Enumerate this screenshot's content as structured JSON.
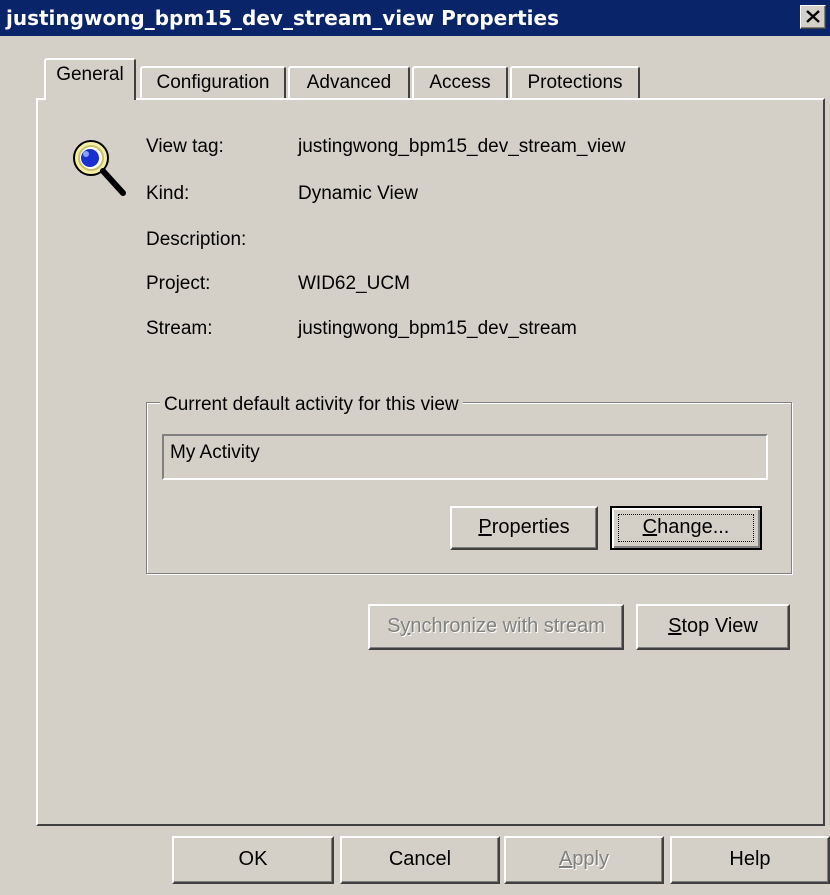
{
  "window": {
    "title": "justingwong_bpm15_dev_stream_view Properties"
  },
  "tabs": [
    {
      "label": "General",
      "active": true
    },
    {
      "label": "Configuration",
      "active": false
    },
    {
      "label": "Advanced",
      "active": false
    },
    {
      "label": "Access",
      "active": false
    },
    {
      "label": "Protections",
      "active": false
    }
  ],
  "general": {
    "icon": "magnifier-icon",
    "fields": [
      {
        "label": "View tag:",
        "value": "justingwong_bpm15_dev_stream_view"
      },
      {
        "label": "Kind:",
        "value": "Dynamic View"
      },
      {
        "label": "Description:",
        "value": ""
      },
      {
        "label": "Project:",
        "value": "WID62_UCM"
      },
      {
        "label": "Stream:",
        "value": "justingwong_bpm15_dev_stream"
      }
    ],
    "activity_group": {
      "legend": "Current default activity for this view",
      "activity": "My Activity",
      "properties_button": {
        "mnemonic": "P",
        "rest": "roperties"
      },
      "change_button": {
        "mnemonic": "C",
        "rest": "hange..."
      }
    },
    "synchronize_button": {
      "pre": "S",
      "mnemonic": "y",
      "rest": "nchronize with stream",
      "disabled": true
    },
    "stop_view_button": {
      "mnemonic": "S",
      "rest": "top View"
    }
  },
  "footer": {
    "ok": "OK",
    "cancel": "Cancel",
    "apply": {
      "mnemonic": "A",
      "rest": "pply",
      "disabled": true
    },
    "help": "Help"
  },
  "colors": {
    "titlebar": "#0a246a",
    "face": "#d4d0c8",
    "disabled_text": "#808080"
  }
}
